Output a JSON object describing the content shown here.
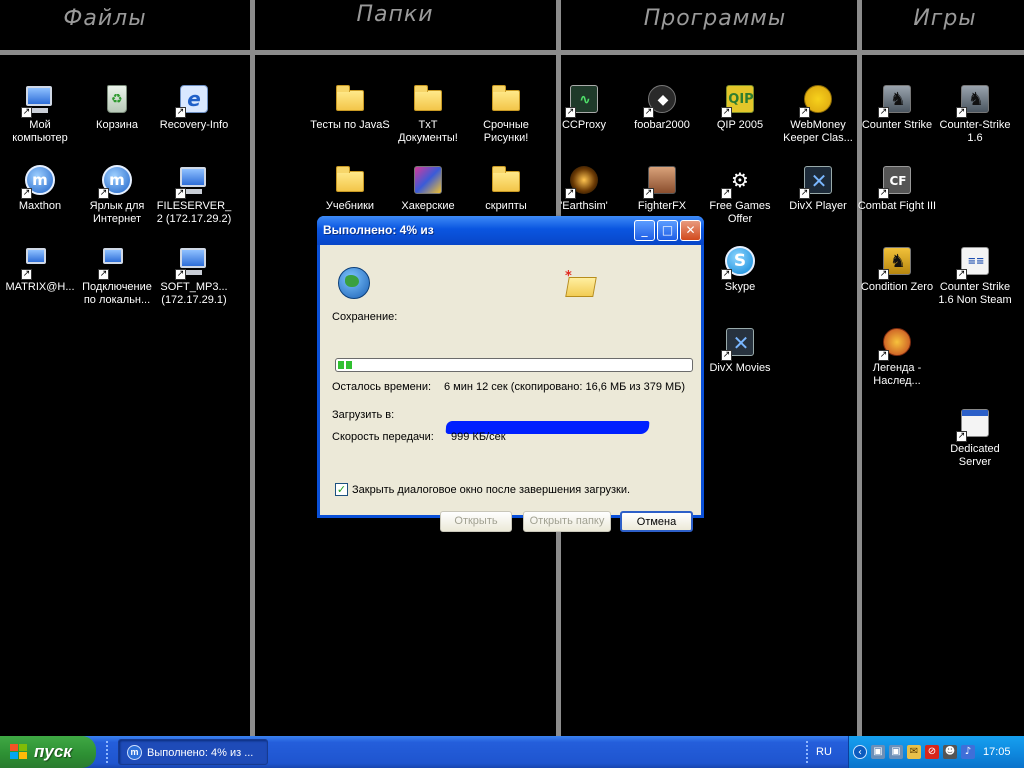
{
  "desktop": {
    "sections": [
      "Файлы",
      "Папки",
      "Программы",
      "Игры"
    ],
    "icons": {
      "my_computer": "Мой компьютер",
      "recycle_bin": "Корзина",
      "recovery_info": "Recovery-Info",
      "maxthon": "Maxthon",
      "internet_shortcut": "Ярлык для Интернет",
      "fileserver": "FILESERVER_2 (172.17.29.2)",
      "matrix": "MATRIX@H...",
      "local_connection": "Подключение по локальн...",
      "soft_mp3": "SOFT_MP3... (172.17.29.1)",
      "tests_java": "Тесты по JavaS",
      "txt_docs": "TxT Документы!",
      "urgent_pics": "Срочные Рисунки!",
      "textbooks": "Учебники",
      "hacker": "Хакерские",
      "scripts": "скрипты",
      "ccproxy": "CCProxy",
      "foobar": "foobar2000",
      "qip": "QIP 2005",
      "webmoney": "WebMoney Keeper Clas...",
      "earthsim": "'Earthsim'",
      "fighterfx": "FighterFX",
      "free_games": "Free Games Offer",
      "divx_player": "DivX Player",
      "skype": "Skype",
      "divx_movies": "DivX Movies",
      "counter_strike": "Counter Strike",
      "cs16": "Counter-Strike 1.6",
      "combat_flight": "Combat Fight III",
      "condition_zero": "Condition Zero",
      "cs_non_steam": "Counter Strike 1.6 Non Steam",
      "legend": "Легенда - Наслед...",
      "dedicated_server": "Dedicated Server"
    }
  },
  "dialog": {
    "title": "Выполнено: 4% из",
    "saving_label": "Сохранение:",
    "progress_percent": 4,
    "time_left_label": "Осталось времени:",
    "time_left_value": "6 мин 12 сек (скопировано: 16,6 МБ из 379 МБ)",
    "download_to_label": "Загрузить в:",
    "speed_label": "Скорость передачи:",
    "speed_value": "999 КБ/сек",
    "close_checkbox_label": "Закрыть диалоговое окно после завершения загрузки.",
    "close_checkbox_checked": true,
    "open_button": "Открыть",
    "open_folder_button": "Открыть папку",
    "cancel_button": "Отмена"
  },
  "taskbar": {
    "start_label": "пуск",
    "task_label": "Выполнено: 4% из ...",
    "language": "RU",
    "clock": "17:05"
  },
  "colors": {
    "taskbar_blue": "#245edb",
    "start_green": "#3fa844",
    "dialog_bg": "#ece9d8",
    "title_blue": "#0a55e0"
  }
}
